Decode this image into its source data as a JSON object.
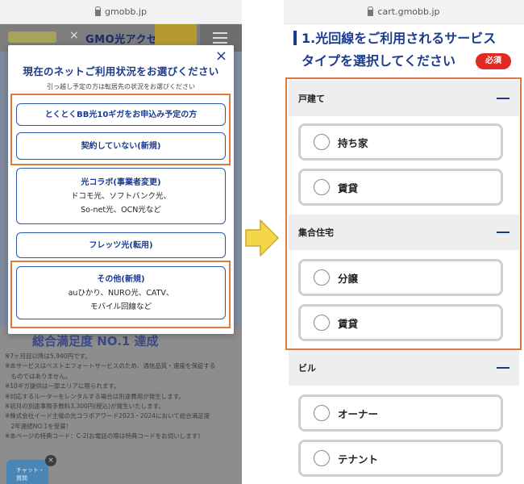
{
  "left": {
    "url": "gmobb.jp",
    "header": {
      "logo_right": "GMO光アクセス",
      "separator": "×"
    },
    "modal": {
      "close": "×",
      "title": "現在のネットご利用状況をお選びください",
      "subtitle": "引っ越し予定の方は転居先の状況をお選びください",
      "options": [
        {
          "line1": "とくとくBB光10ギガをお申込み予定の方",
          "line2": ""
        },
        {
          "line1": "契約していない(新規)",
          "line2": ""
        },
        {
          "line1": "光コラボ(事業者変更)",
          "line2": "ドコモ光、ソフトバンク光、",
          "line3": "So-net光、OCN光など"
        },
        {
          "line1": "フレッツ光(転用)",
          "line2": ""
        },
        {
          "line1": "その他(新規)",
          "line2": "auひかり、NURO光、CATV、",
          "line3": "モバイル回線など"
        }
      ]
    },
    "page": {
      "award": "総合満足度 NO.1 達成",
      "notes": [
        "※7ヶ月目以降は5,940円です。",
        "※本サービスはベストエフォートサービスのため、通信品質・速度を保証する",
        "　ものではありません。",
        "※10ギガ提供は一部エリアに限られます。",
        "※対応するルーターをレンタルする場合は別途費用が発生します。",
        "※初月の別途事務手数料3,300円(税込)が発生いたします。",
        "※株式会社イード主催の光コラボアワード2023・2024において総合満足度",
        "　2年連続NO.1を受賞！",
        "※本ページの特典コード：C-2(お電話の際は特典コードをお伺いします)"
      ],
      "chat_label": "チャット・質問",
      "chat_close": "×"
    }
  },
  "right": {
    "url": "cart.gmobb.jp",
    "title_line1": "1.光回線をご利用されるサービス",
    "title_line2": "タイプを選択してください",
    "required_badge": "必須",
    "sections": [
      {
        "label": "戸建て",
        "options": [
          "持ち家",
          "賃貸"
        ]
      },
      {
        "label": "集合住宅",
        "options": [
          "分譲",
          "賃貸"
        ]
      },
      {
        "label": "ビル",
        "options": [
          "オーナー",
          "テナント"
        ]
      }
    ]
  },
  "colors": {
    "brand_blue": "#1b3b8f",
    "highlight_orange": "#e07a3a",
    "required_red": "#e02a24",
    "arrow_yellow": "#f5d64a"
  }
}
